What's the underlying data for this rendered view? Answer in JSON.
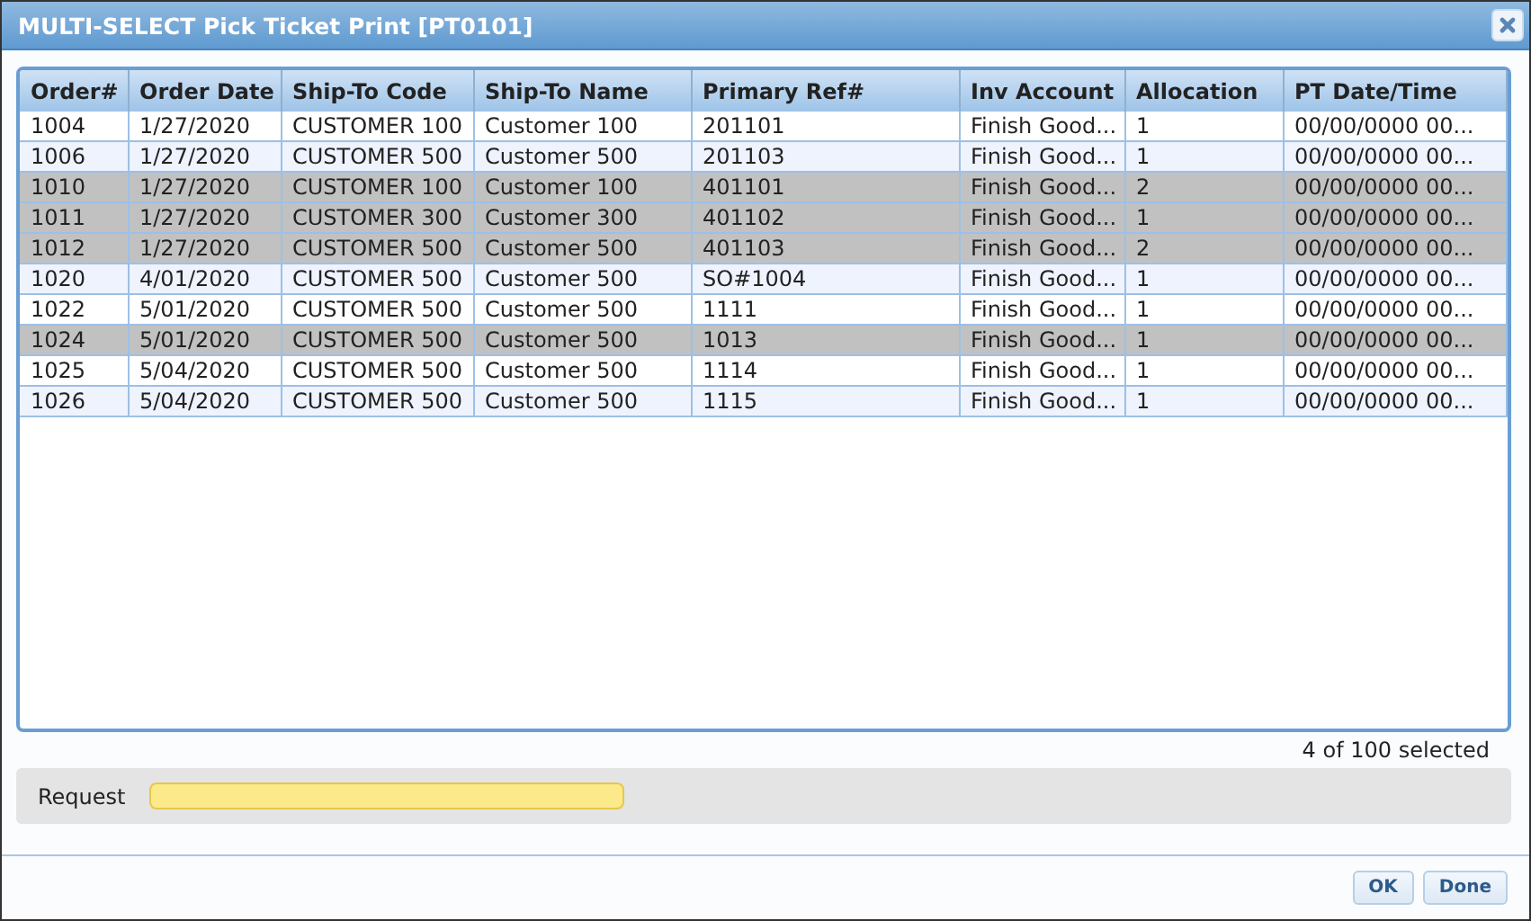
{
  "window": {
    "title": "MULTI-SELECT Pick Ticket Print [PT0101]"
  },
  "table": {
    "columns": [
      "Order#",
      "Order Date",
      "Ship-To Code",
      "Ship-To Name",
      "Primary Ref#",
      "Inv Account",
      "Allocation",
      "PT Date/Time"
    ],
    "rows": [
      {
        "selected": false,
        "cells": [
          "1004",
          "1/27/2020",
          "CUSTOMER 100",
          "Customer 100",
          "201101",
          "Finish Good...",
          "1",
          "00/00/0000 00..."
        ]
      },
      {
        "selected": false,
        "cells": [
          "1006",
          "1/27/2020",
          "CUSTOMER 500",
          "Customer 500",
          "201103",
          "Finish Good...",
          "1",
          "00/00/0000 00..."
        ]
      },
      {
        "selected": true,
        "cells": [
          "1010",
          "1/27/2020",
          "CUSTOMER 100",
          "Customer 100",
          "401101",
          "Finish Good...",
          "2",
          "00/00/0000 00..."
        ]
      },
      {
        "selected": true,
        "cells": [
          "1011",
          "1/27/2020",
          "CUSTOMER 300",
          "Customer 300",
          "401102",
          "Finish Good...",
          "1",
          "00/00/0000 00..."
        ]
      },
      {
        "selected": true,
        "cells": [
          "1012",
          "1/27/2020",
          "CUSTOMER 500",
          "Customer 500",
          "401103",
          "Finish Good...",
          "2",
          "00/00/0000 00..."
        ]
      },
      {
        "selected": false,
        "cells": [
          "1020",
          "4/01/2020",
          "CUSTOMER 500",
          "Customer 500",
          "SO#1004",
          "Finish Good...",
          "1",
          "00/00/0000 00..."
        ]
      },
      {
        "selected": false,
        "cells": [
          "1022",
          "5/01/2020",
          "CUSTOMER 500",
          "Customer 500",
          "1111",
          "Finish Good...",
          "1",
          "00/00/0000 00..."
        ]
      },
      {
        "selected": true,
        "cells": [
          "1024",
          "5/01/2020",
          "CUSTOMER 500",
          "Customer 500",
          "1013",
          "Finish Good...",
          "1",
          "00/00/0000 00..."
        ]
      },
      {
        "selected": false,
        "cells": [
          "1025",
          "5/04/2020",
          "CUSTOMER 500",
          "Customer 500",
          "1114",
          "Finish Good...",
          "1",
          "00/00/0000 00..."
        ]
      },
      {
        "selected": false,
        "cells": [
          "1026",
          "5/04/2020",
          "CUSTOMER 500",
          "Customer 500",
          "1115",
          "Finish Good...",
          "1",
          "00/00/0000 00..."
        ]
      }
    ]
  },
  "selection_count": "4 of 100 selected",
  "request": {
    "label": "Request"
  },
  "buttons": [
    "OK",
    "Done"
  ]
}
